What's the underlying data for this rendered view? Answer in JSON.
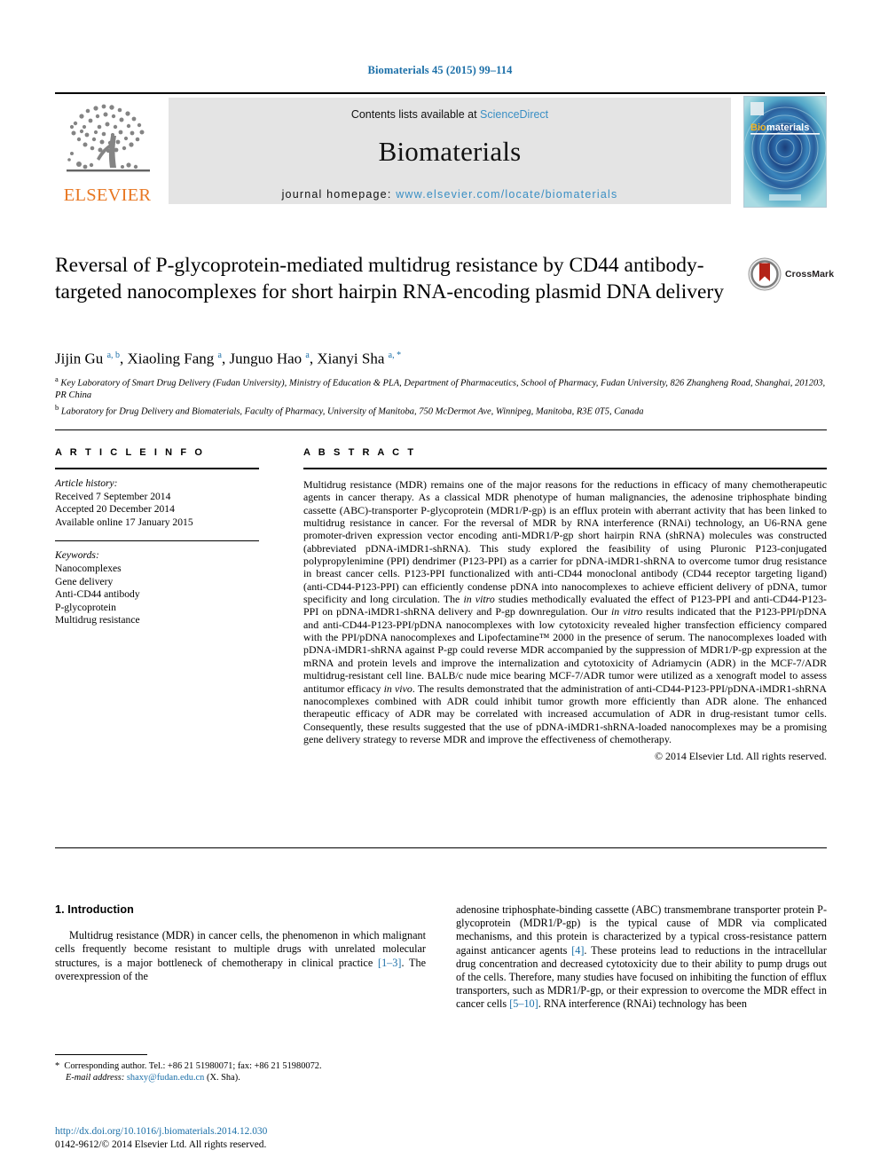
{
  "running_head": "Biomaterials 45 (2015) 99–114",
  "masthead": {
    "contents_prefix": "Contents lists available at",
    "sciencedirect": "ScienceDirect",
    "journal_name": "Biomaterials",
    "homepage_prefix": "journal homepage:",
    "homepage_url": "www.elsevier.com/locate/biomaterials",
    "publisher_wordmark": "ELSEVIER",
    "publisher_logo_icon": "elsevier-tree-icon",
    "cover_icon": "journal-cover-thumbnail",
    "cover_title": "Biomaterials"
  },
  "article": {
    "title": "Reversal of P-glycoprotein-mediated multidrug resistance by CD44 antibody-targeted nanocomplexes for short hairpin RNA-encoding plasmid DNA delivery",
    "crossmark_label": "CrossMark",
    "crossmark_icon": "crossmark-logo-icon",
    "authors_html": "Jijin Gu <sup>a, b</sup>, Xiaoling Fang <sup>a</sup>, Junguo Hao <sup>a</sup>, Xianyi Sha <sup>a,&nbsp;*</sup>",
    "affiliations": [
      {
        "label": "a",
        "text": "Key Laboratory of Smart Drug Delivery (Fudan University), Ministry of Education & PLA, Department of Pharmaceutics, School of Pharmacy, Fudan University, 826 Zhangheng Road, Shanghai, 201203, PR China"
      },
      {
        "label": "b",
        "text": "Laboratory for Drug Delivery and Biomaterials, Faculty of Pharmacy, University of Manitoba, 750 McDermot Ave, Winnipeg, Manitoba, R3E 0T5, Canada"
      }
    ]
  },
  "article_info": {
    "heading": "A R T I C L E   I N F O",
    "history_label": "Article history:",
    "history": [
      "Received 7 September 2014",
      "Accepted 20 December 2014",
      "Available online 17 January 2015"
    ],
    "keywords_label": "Keywords:",
    "keywords": [
      "Nanocomplexes",
      "Gene delivery",
      "Anti-CD44 antibody",
      "P-glycoprotein",
      "Multidrug resistance"
    ]
  },
  "abstract": {
    "heading": "A B S T R A C T",
    "text_html": "Multidrug resistance (MDR) remains one of the major reasons for the reductions in efficacy of many chemotherapeutic agents in cancer therapy. As a classical MDR phenotype of human malignancies, the adenosine triphosphate binding cassette (ABC)-transporter P-glycoprotein (MDR1/P-gp) is an efflux protein with aberrant activity that has been linked to multidrug resistance in cancer. For the reversal of MDR by RNA interference (RNAi) technology, an U6-RNA gene promoter-driven expression vector encoding anti-MDR1/P-gp short hairpin RNA (shRNA) molecules was constructed (abbreviated pDNA-iMDR1-shRNA). This study explored the feasibility of using Pluronic P123-conjugated polypropylenimine (PPI) dendrimer (P123-PPI) as a carrier for pDNA-iMDR1-shRNA to overcome tumor drug resistance in breast cancer cells. P123-PPI functionalized with anti-CD44 monoclonal antibody (CD44 receptor targeting ligand) (anti-CD44-P123-PPI) can efficiently condense pDNA into nanocomplexes to achieve efficient delivery of pDNA, tumor specificity and long circulation. The <i>in vitro</i> studies methodically evaluated the effect of P123-PPI and anti-CD44-P123-PPI on pDNA-iMDR1-shRNA delivery and P-gp downregulation. Our <i>in vitro</i> results indicated that the P123-PPI/pDNA and anti-CD44-P123-PPI/pDNA nanocomplexes with low cytotoxicity revealed higher transfection efficiency compared with the PPI/pDNA nanocomplexes and Lipofectamine™ 2000 in the presence of serum. The nanocomplexes loaded with pDNA-iMDR1-shRNA against P-gp could reverse MDR accompanied by the suppression of MDR1/P-gp expression at the mRNA and protein levels and improve the internalization and cytotoxicity of Adriamycin (ADR) in the MCF-7/ADR multidrug-resistant cell line. BALB/c nude mice bearing MCF-7/ADR tumor were utilized as a xenograft model to assess antitumor efficacy <i>in vivo</i>. The results demonstrated that the administration of anti-CD44-P123-PPI/pDNA-iMDR1-shRNA nanocomplexes combined with ADR could inhibit tumor growth more efficiently than ADR alone. The enhanced therapeutic efficacy of ADR may be correlated with increased accumulation of ADR in drug-resistant tumor cells. Consequently, these results suggested that the use of pDNA-iMDR1-shRNA-loaded nanocomplexes may be a promising gene delivery strategy to reverse MDR and improve the effectiveness of chemotherapy.",
    "copyright": "© 2014 Elsevier Ltd. All rights reserved."
  },
  "introduction": {
    "heading": "1.  Introduction",
    "left_paragraph_html": "Multidrug resistance (MDR) in cancer cells, the phenomenon in which malignant cells frequently become resistant to multiple drugs with unrelated molecular structures, is a major bottleneck of chemotherapy in clinical practice <span class=\"ref\">[1–3]</span>. The overexpression of the",
    "right_paragraph_html": "adenosine triphosphate-binding cassette (ABC) transmembrane transporter protein P-glycoprotein (MDR1/P-gp) is the typical cause of MDR via complicated mechanisms, and this protein is characterized by a typical cross-resistance pattern against anticancer agents <span class=\"ref\">[4]</span>. These proteins lead to reductions in the intracellular drug concentration and decreased cytotoxicity due to their ability to pump drugs out of the cells. Therefore, many studies have focused on inhibiting the function of efflux transporters, such as MDR1/P-gp, or their expression to overcome the MDR effect in cancer cells <span class=\"ref\">[5–10]</span>. RNA interference (RNAi) technology has been"
  },
  "footer": {
    "corresponding_html": "<span class=\"star\">*</span>&nbsp; Corresponding author. Tel.: +86 21 51980071; fax: +86 21 51980072.",
    "email_label": "E-mail address:",
    "email": "shaxy@fudan.edu.cn",
    "email_suffix": "(X. Sha).",
    "doi": "http://dx.doi.org/10.1016/j.biomaterials.2014.12.030",
    "issn_line": "0142-9612/© 2014 Elsevier Ltd. All rights reserved."
  },
  "colors": {
    "link_blue": "#1b6fa8",
    "elsevier_orange": "#E87722",
    "masthead_grey": "#e4e4e4"
  }
}
